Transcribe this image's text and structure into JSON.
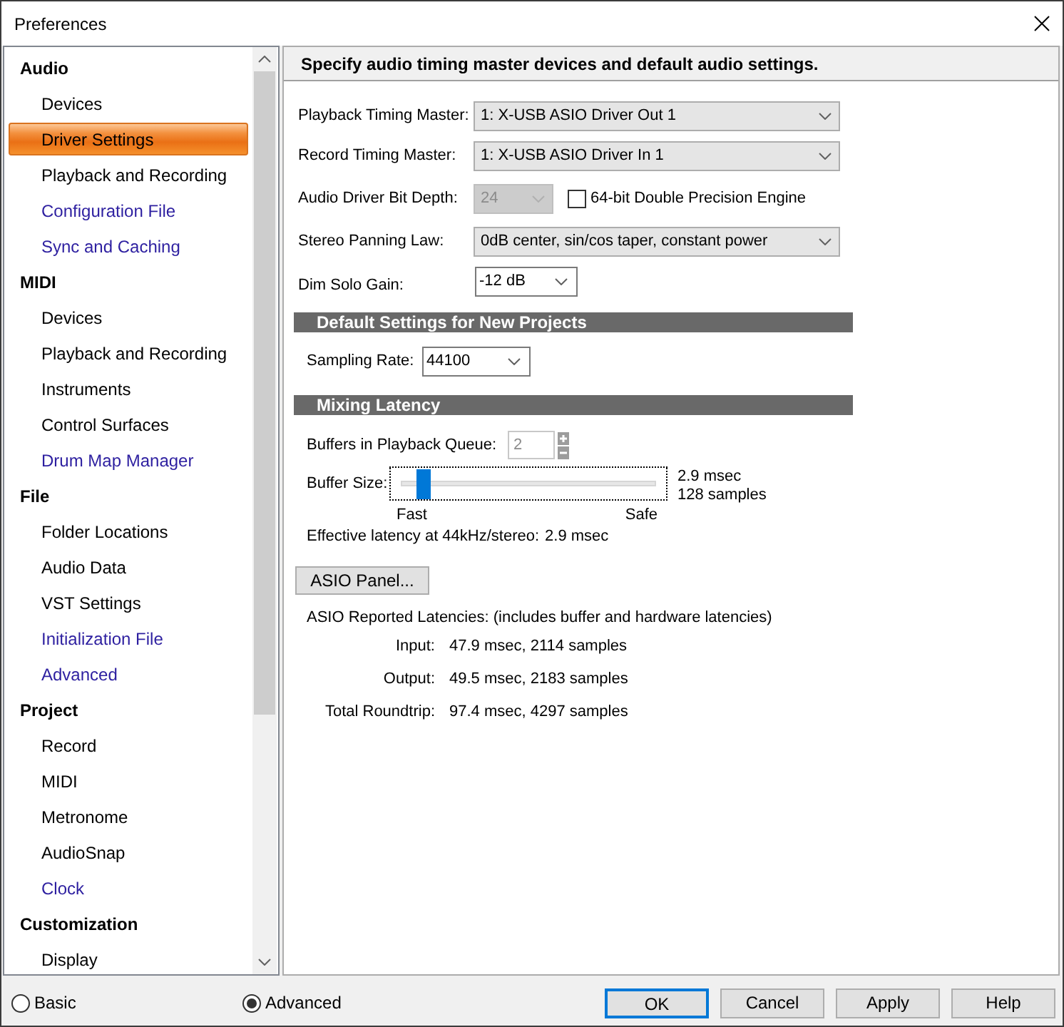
{
  "window": {
    "title": "Preferences"
  },
  "sidebar": {
    "items": [
      {
        "label": "Audio",
        "selected": false,
        "children": [
          {
            "label": "Devices",
            "selected": false,
            "color": "#000000"
          },
          {
            "label": "Driver Settings",
            "selected": true,
            "color": "#000000"
          },
          {
            "label": "Playback and Recording",
            "selected": false,
            "color": "#000000"
          },
          {
            "label": "Configuration File",
            "selected": false,
            "color": "#2d1fa0"
          },
          {
            "label": "Sync and Caching",
            "selected": false,
            "color": "#2d1fa0"
          }
        ]
      },
      {
        "label": "MIDI",
        "selected": false,
        "children": [
          {
            "label": "Devices",
            "selected": false,
            "color": "#000000"
          },
          {
            "label": "Playback and Recording",
            "selected": false,
            "color": "#000000"
          },
          {
            "label": "Instruments",
            "selected": false,
            "color": "#000000"
          },
          {
            "label": "Control Surfaces",
            "selected": false,
            "color": "#000000"
          },
          {
            "label": "Drum Map Manager",
            "selected": false,
            "color": "#2d1fa0"
          }
        ]
      },
      {
        "label": "File",
        "selected": false,
        "children": [
          {
            "label": "Folder Locations",
            "selected": false,
            "color": "#000000"
          },
          {
            "label": "Audio Data",
            "selected": false,
            "color": "#000000"
          },
          {
            "label": "VST Settings",
            "selected": false,
            "color": "#000000"
          },
          {
            "label": "Initialization File",
            "selected": false,
            "color": "#2d1fa0"
          },
          {
            "label": "Advanced",
            "selected": false,
            "color": "#2d1fa0"
          }
        ]
      },
      {
        "label": "Project",
        "selected": false,
        "children": [
          {
            "label": "Record",
            "selected": false,
            "color": "#000000"
          },
          {
            "label": "MIDI",
            "selected": false,
            "color": "#000000"
          },
          {
            "label": "Metronome",
            "selected": false,
            "color": "#000000"
          },
          {
            "label": "AudioSnap",
            "selected": false,
            "color": "#000000"
          },
          {
            "label": "Clock",
            "selected": false,
            "color": "#2d1fa0"
          }
        ]
      },
      {
        "label": "Customization",
        "selected": false,
        "children": [
          {
            "label": "Display",
            "selected": false,
            "color": "#000000"
          }
        ]
      }
    ]
  },
  "panel": {
    "heading": "Specify audio timing master devices and default audio settings.",
    "playback_timing_master": {
      "label": "Playback Timing Master:",
      "value": "1: X-USB ASIO Driver Out 1"
    },
    "record_timing_master": {
      "label": "Record Timing Master:",
      "value": "1: X-USB ASIO Driver In 1"
    },
    "audio_driver_bit_depth": {
      "label": "Audio Driver Bit Depth:",
      "value": "24",
      "disabled": true
    },
    "double_precision_engine": {
      "label": "64-bit Double Precision Engine",
      "checked": false
    },
    "stereo_panning_law": {
      "label": "Stereo Panning Law:",
      "value": "0dB center, sin/cos taper, constant power"
    },
    "dim_solo_gain": {
      "label": "Dim Solo Gain:",
      "value": "-12 dB"
    },
    "default_settings": {
      "title": "Default Settings for New Projects",
      "sampling_rate": {
        "label": "Sampling Rate:",
        "value": "44100"
      }
    },
    "mixing_latency": {
      "title": "Mixing Latency",
      "buffers_in_playback_queue": {
        "label": "Buffers in Playback Queue:",
        "value": "2",
        "disabled": true
      },
      "buffer_size": {
        "label": "Buffer Size:",
        "level": 0.065,
        "readings": [
          "2.9 msec",
          "128 samples"
        ],
        "min_label": "Fast",
        "max_label": "Safe"
      },
      "effective_latency": {
        "label": "Effective latency at 44kHz/stereo:",
        "value": "2.9 msec"
      },
      "asio_panel_button": "ASIO Panel...",
      "reported_latencies": {
        "title": "ASIO Reported Latencies: (includes buffer and hardware latencies)",
        "rows": [
          {
            "label": "Input:",
            "value": "47.9 msec, 2114 samples"
          },
          {
            "label": "Output:",
            "value": "49.5 msec, 2183 samples"
          },
          {
            "label": "Total Roundtrip:",
            "value": "97.4 msec, 4297 samples"
          }
        ]
      }
    }
  },
  "footer": {
    "modes": [
      {
        "label": "Basic",
        "selected": false
      },
      {
        "label": "Advanced",
        "selected": true
      }
    ],
    "buttons": [
      {
        "label": "OK",
        "default": true
      },
      {
        "label": "Cancel",
        "default": false
      },
      {
        "label": "Apply",
        "default": false
      },
      {
        "label": "Help",
        "default": false
      }
    ]
  }
}
